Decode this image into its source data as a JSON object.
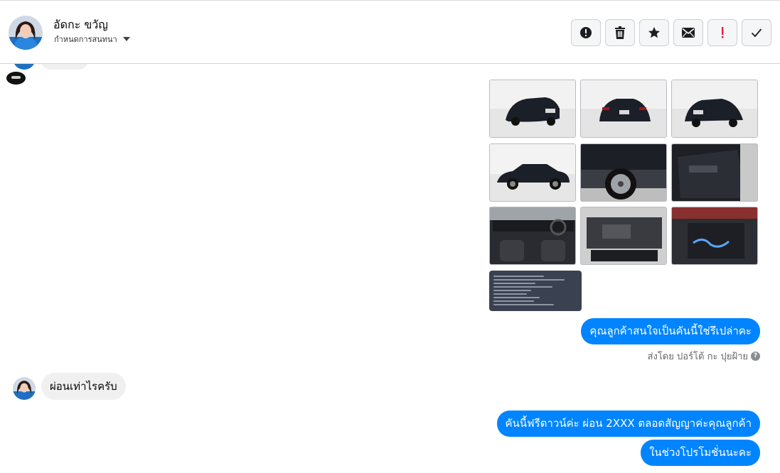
{
  "header": {
    "contact_name": "อัดกะ ขวัญ",
    "conversation_setting": "กำหนดการสนทนา",
    "actions": [
      {
        "icon": "alert-circle-icon",
        "label": "Mark as spam"
      },
      {
        "icon": "trash-icon",
        "label": "Delete"
      },
      {
        "icon": "star-icon",
        "label": "Star"
      },
      {
        "icon": "envelope-icon",
        "label": "Mark as unread"
      },
      {
        "icon": "exclamation-icon",
        "label": "Follow up"
      },
      {
        "icon": "check-icon",
        "label": "Mark as done"
      }
    ],
    "accent_color": "#e41e3f"
  },
  "thread": {
    "photos": [
      {
        "icon": "car-photo-rear-three-quarter"
      },
      {
        "icon": "car-photo-rear"
      },
      {
        "icon": "car-photo-rear-right"
      },
      {
        "icon": "car-photo-side"
      },
      {
        "icon": "car-photo-wheel"
      },
      {
        "icon": "car-photo-door-panel"
      },
      {
        "icon": "car-photo-interior"
      },
      {
        "icon": "car-photo-engine"
      },
      {
        "icon": "car-photo-battery"
      }
    ],
    "spec_card": {
      "icon": "vehicle-spec-card"
    },
    "messages_out_1": [
      "คุณลูกค้าสนใจเป็นคันนี้ใช่รึเปล่าคะ"
    ],
    "sent_by": "ส่งโดย ปอร์โต้ กะ ปุยฝ้าย",
    "message_in": "ผ่อนเท่าไรครับ",
    "messages_out_2": [
      "คันนี้ฟรีดาวน์ค่ะ ผ่อน 2XXX ตลอดสัญญาค่ะคุณลูกค้า",
      "ในช่วงโปรโมชั่นนะคะ"
    ],
    "colors": {
      "outgoing_bubble": "#0084ff",
      "incoming_bubble": "#f0f0f0"
    }
  }
}
